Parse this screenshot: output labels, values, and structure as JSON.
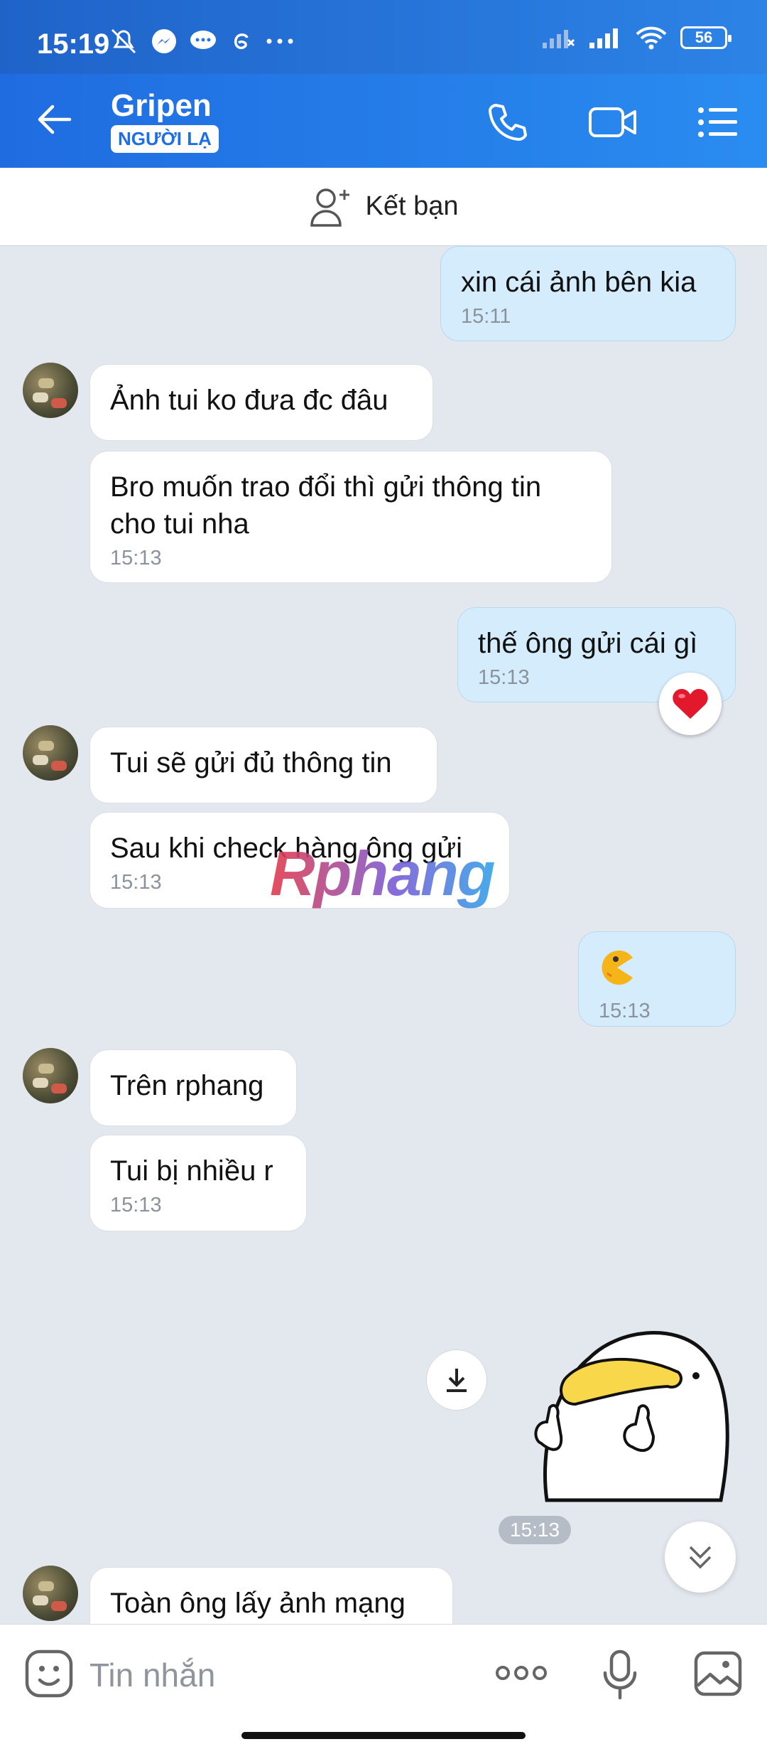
{
  "status_bar": {
    "time": "15:19",
    "battery": "56"
  },
  "header": {
    "title": "Gripen",
    "badge": "NGƯỜI LẠ"
  },
  "add_friend": {
    "label": "Kết bạn"
  },
  "messages": [
    {
      "text": "xin cái ảnh bên kia",
      "time": "15:11"
    },
    {
      "text": "Ảnh tui ko đưa đc đâu"
    },
    {
      "text": "Bro muốn trao đổi thì gửi thông tin cho tui nha",
      "time": "15:13"
    },
    {
      "text": "thế ông gửi cái gì",
      "time": "15:13"
    },
    {
      "text": "Tui sẽ gửi đủ thông tin"
    },
    {
      "text": "Sau khi check hàng ông gửi",
      "time": "15:13"
    },
    {
      "text": "15:13"
    },
    {
      "text": "Trên rphang"
    },
    {
      "text": "Tui bị nhiều r",
      "time": "15:13"
    },
    {
      "text": "Toàn ông lấy ảnh mạng"
    }
  ],
  "sticker_time": "15:13",
  "watermark": "Rphang",
  "input": {
    "placeholder": "Tin nhắn"
  }
}
